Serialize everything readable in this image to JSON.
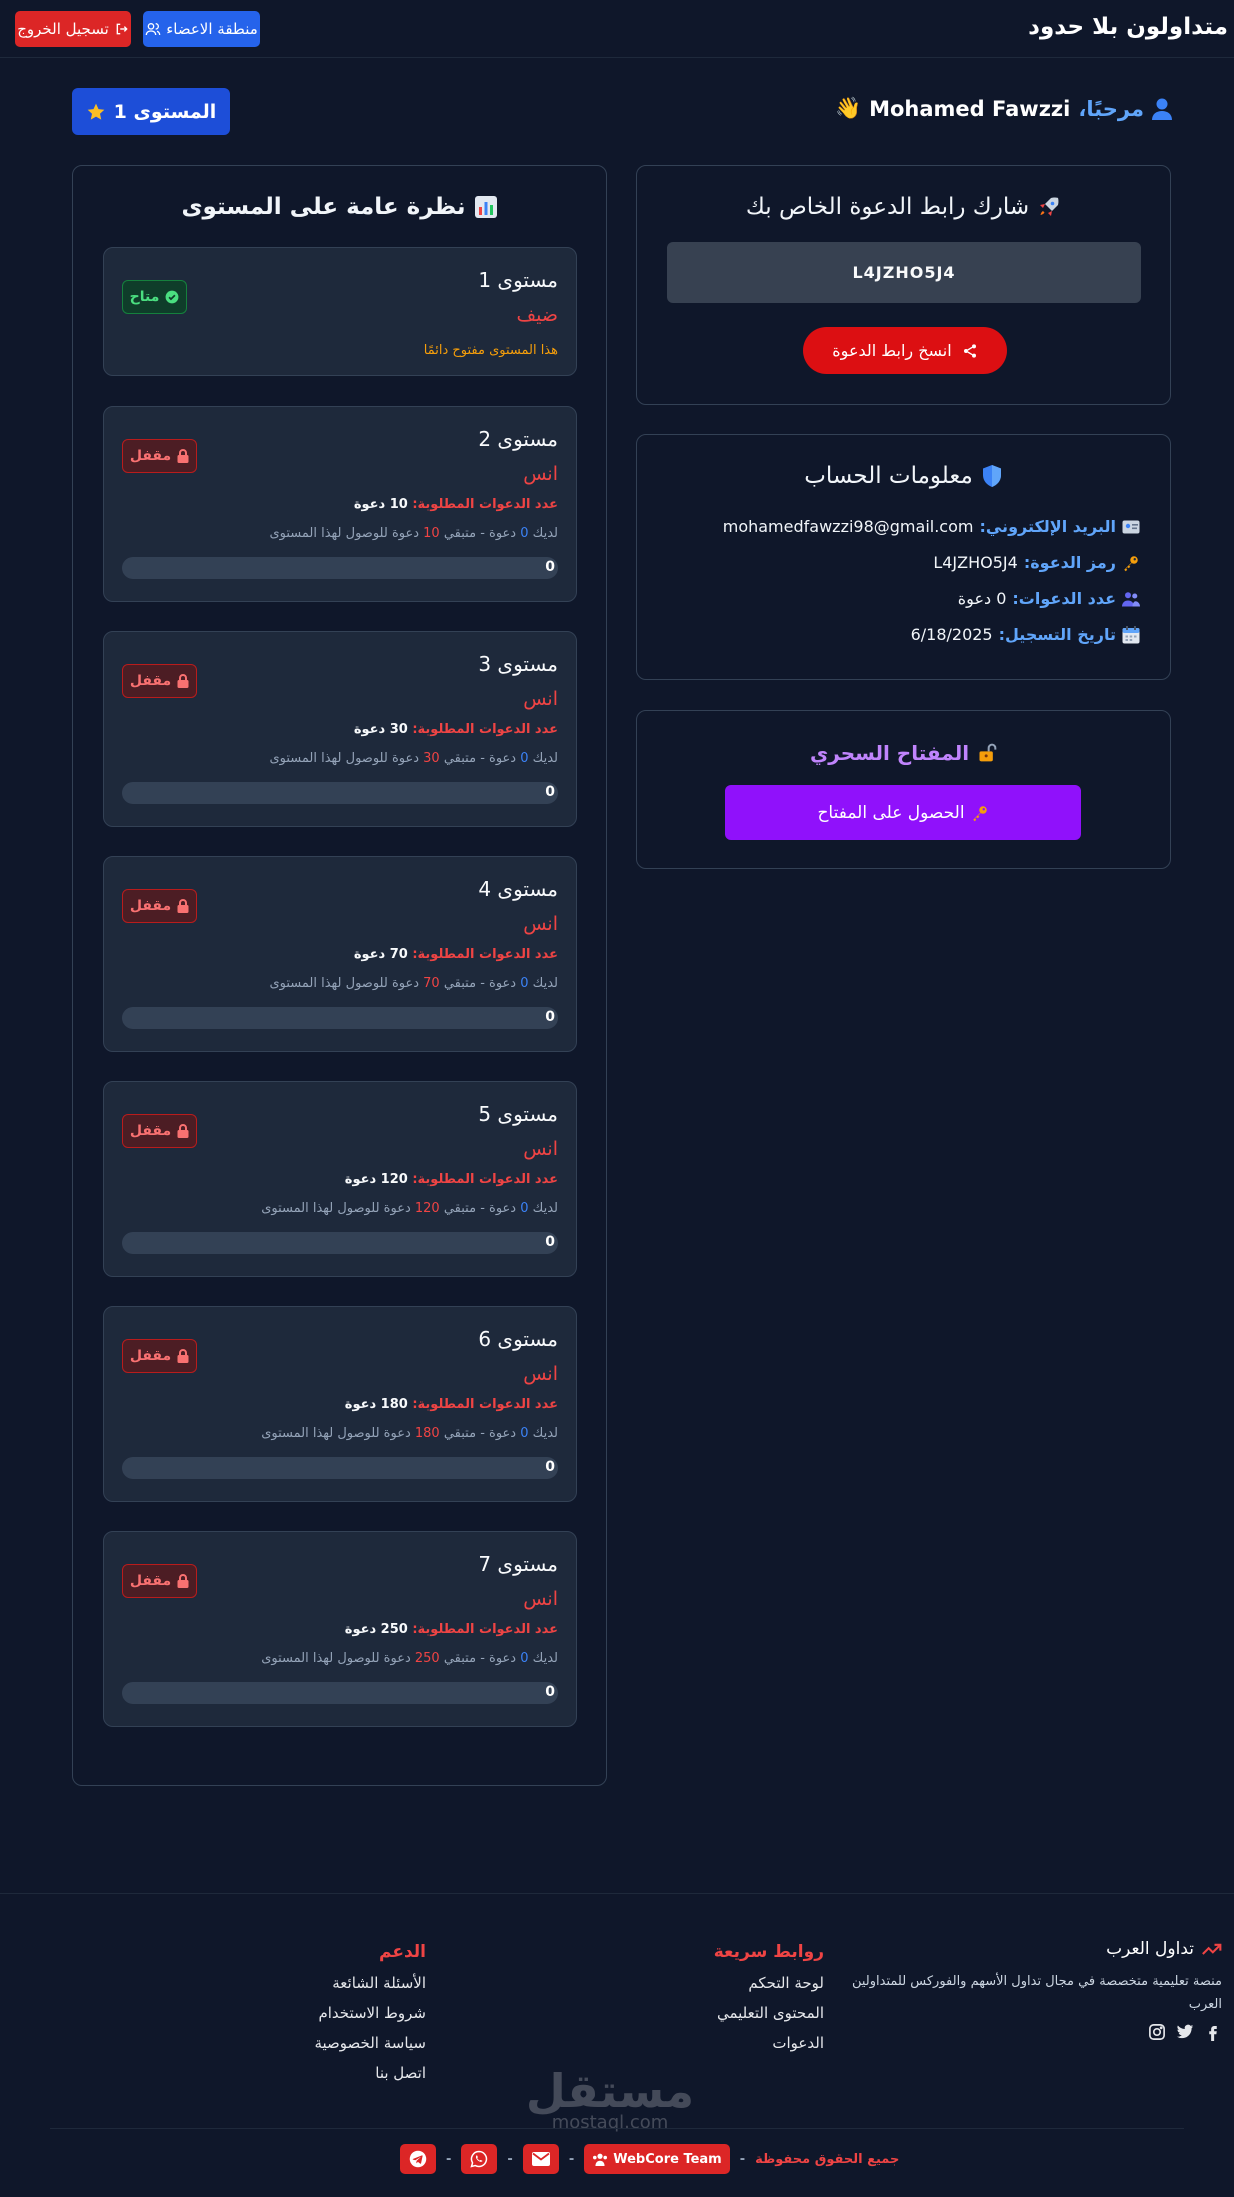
{
  "header": {
    "brand": "متداولون بلا حدود",
    "members_label": "منطقة الاعضاء",
    "logout_label": "تسجيل الخروج"
  },
  "welcome": {
    "greeting": "مرحبًا،",
    "username": "Mohamed Fawzzi",
    "wave": "👋",
    "level_badge": "المستوى 1"
  },
  "invite": {
    "title": "شارك رابط الدعوة الخاص بك",
    "icon": "rocket-icon",
    "code": "L4JZHO5J4",
    "copy_label": "انسخ رابط الدعوة"
  },
  "account": {
    "title": "معلومات الحساب",
    "email_label": "البريد الإلكتروني:",
    "email_value": "mohamedfawzzi98@gmail.com",
    "code_label": "رمز الدعوة:",
    "code_value": "L4JZHO5J4",
    "invites_label": "عدد الدعوات:",
    "invites_value": "0 دعوة",
    "date_label": "تاريخ التسجيل:",
    "date_value": "6/18/2025"
  },
  "magic": {
    "title": "المفتاح السحري",
    "button": "الحصول على المفتاح"
  },
  "overview": {
    "title": "نظرة عامة على المستوى",
    "levels": [
      {
        "name": "مستوى 1",
        "sub": "ضيف",
        "status": "متاح",
        "note": "هذا المستوى مفتوح دائمًا"
      },
      {
        "name": "مستوى 2",
        "sub": "انس",
        "status": "مقفل",
        "req_label": "عدد الدعوات المطلوبة:",
        "req_value": "10 دعوة",
        "rem_a": "لديك ",
        "rem_cur": "0",
        "rem_b": " دعوة - متبقي ",
        "rem_left": "10",
        "rem_c": " دعوة للوصول لهذا المستوى",
        "progress": 0,
        "bar_value": "0"
      },
      {
        "name": "مستوى 3",
        "sub": "انس",
        "status": "مقفل",
        "req_label": "عدد الدعوات المطلوبة:",
        "req_value": "30 دعوة",
        "rem_a": "لديك ",
        "rem_cur": "0",
        "rem_b": " دعوة - متبقي ",
        "rem_left": "30",
        "rem_c": " دعوة للوصول لهذا المستوى",
        "progress": 0,
        "bar_value": "0"
      },
      {
        "name": "مستوى 4",
        "sub": "انس",
        "status": "مقفل",
        "req_label": "عدد الدعوات المطلوبة:",
        "req_value": "70 دعوة",
        "rem_a": "لديك ",
        "rem_cur": "0",
        "rem_b": " دعوة - متبقي ",
        "rem_left": "70",
        "rem_c": " دعوة للوصول لهذا المستوى",
        "progress": 0,
        "bar_value": "0"
      },
      {
        "name": "مستوى 5",
        "sub": "انس",
        "status": "مقفل",
        "req_label": "عدد الدعوات المطلوبة:",
        "req_value": "120 دعوة",
        "rem_a": "لديك ",
        "rem_cur": "0",
        "rem_b": " دعوة - متبقي ",
        "rem_left": "120",
        "rem_c": " دعوة للوصول لهذا المستوى",
        "progress": 0,
        "bar_value": "0"
      },
      {
        "name": "مستوى 6",
        "sub": "انس",
        "status": "مقفل",
        "req_label": "عدد الدعوات المطلوبة:",
        "req_value": "180 دعوة",
        "rem_a": "لديك ",
        "rem_cur": "0",
        "rem_b": " دعوة - متبقي ",
        "rem_left": "180",
        "rem_c": " دعوة للوصول لهذا المستوى",
        "progress": 0,
        "bar_value": "0"
      },
      {
        "name": "مستوى 7",
        "sub": "انس",
        "status": "مقفل",
        "req_label": "عدد الدعوات المطلوبة:",
        "req_value": "250 دعوة",
        "rem_a": "لديك ",
        "rem_cur": "0",
        "rem_b": " دعوة - متبقي ",
        "rem_left": "250",
        "rem_c": " دعوة للوصول لهذا المستوى",
        "progress": 0,
        "bar_value": "0"
      }
    ]
  },
  "footer": {
    "brand_title": "تداول العرب",
    "brand_desc": "منصة تعليمية متخصصة في مجال تداول الأسهم والفوركس للمتداولين العرب",
    "quick_title": "روابط سريعة",
    "quick_links": [
      "لوحة التحكم",
      "المحتوى التعليمي",
      "الدعوات"
    ],
    "support_title": "الدعم",
    "support_links": [
      "الأسئلة الشائعة",
      "شروط الاستخدام",
      "سياسة الخصوصية",
      "اتصل بنا"
    ],
    "copyright": "جميع الحقوق محفوظة",
    "team": "WebCore Team",
    "separator": "-",
    "watermark_ar": "مستقل",
    "watermark_en": "mostaql.com"
  },
  "colors": {
    "background": "#0f172a",
    "card": "#1e293b",
    "accent_red": "#dc2626",
    "accent_blue": "#2563eb",
    "accent_purple": "#9011fb"
  }
}
